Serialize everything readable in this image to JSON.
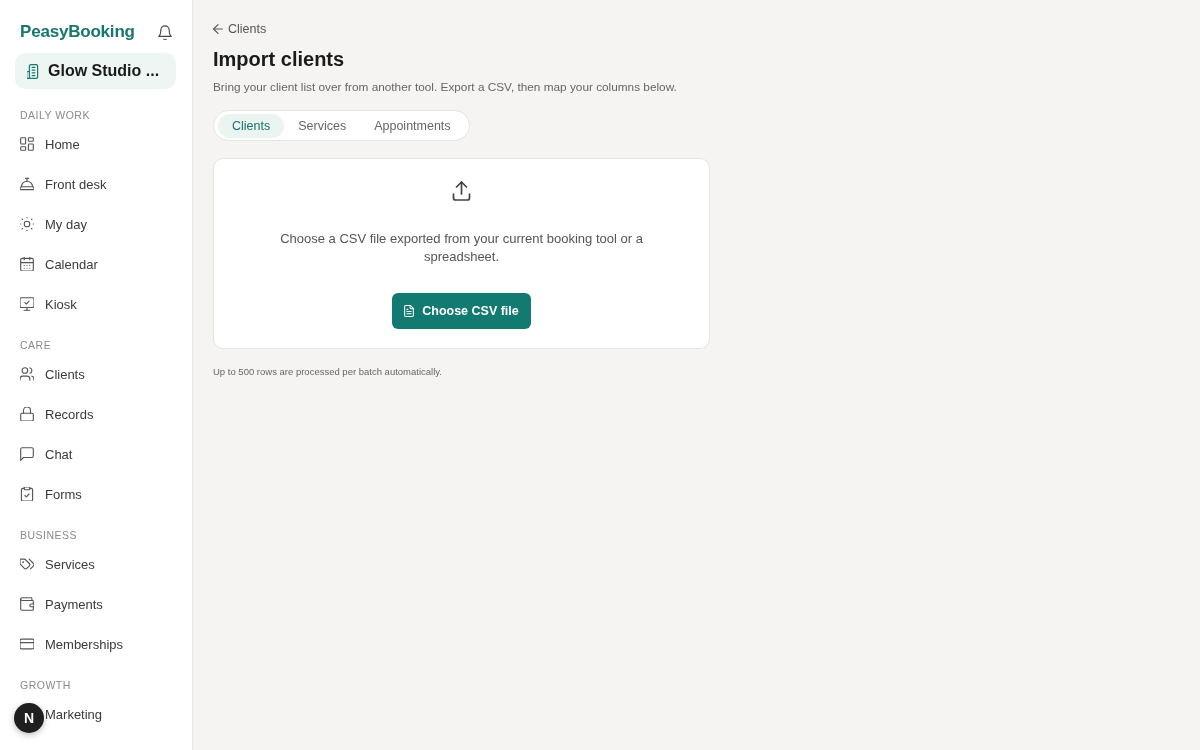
{
  "sidebar": {
    "brand": "PeasyBooking",
    "workspace": "Glow Studio ...",
    "sections": [
      {
        "label": "DAILY WORK",
        "items": [
          {
            "label": "Home",
            "selected": false
          },
          {
            "label": "Front desk",
            "selected": false
          },
          {
            "label": "My day",
            "selected": false
          },
          {
            "label": "Calendar",
            "selected": false
          },
          {
            "label": "Kiosk",
            "selected": false
          }
        ]
      },
      {
        "label": "CARE",
        "items": [
          {
            "label": "Clients",
            "selected": false
          },
          {
            "label": "Records",
            "selected": false
          },
          {
            "label": "Chat",
            "selected": false
          },
          {
            "label": "Forms",
            "selected": false
          }
        ]
      },
      {
        "label": "BUSINESS",
        "items": [
          {
            "label": "Services",
            "selected": false
          },
          {
            "label": "Payments",
            "selected": false
          },
          {
            "label": "Memberships",
            "selected": false
          }
        ]
      },
      {
        "label": "GROWTH",
        "items": [
          {
            "label": "Marketing",
            "selected": false
          }
        ]
      }
    ]
  },
  "main": {
    "back_link": "Clients",
    "title": "Import clients",
    "subtitle": "Bring your client list over from another tool. Export a CSV, then map your columns below.",
    "tabs": [
      {
        "label": "Clients",
        "selected": true
      },
      {
        "label": "Services",
        "selected": false
      },
      {
        "label": "Appointments",
        "selected": false
      }
    ],
    "upload": {
      "prompt": "Choose a CSV file exported from your current booking tool or a spreadsheet.",
      "button": "Choose CSV file"
    },
    "note": "Up to 500 rows are processed per batch automatically."
  },
  "dev_badge": {
    "label": "N"
  }
}
